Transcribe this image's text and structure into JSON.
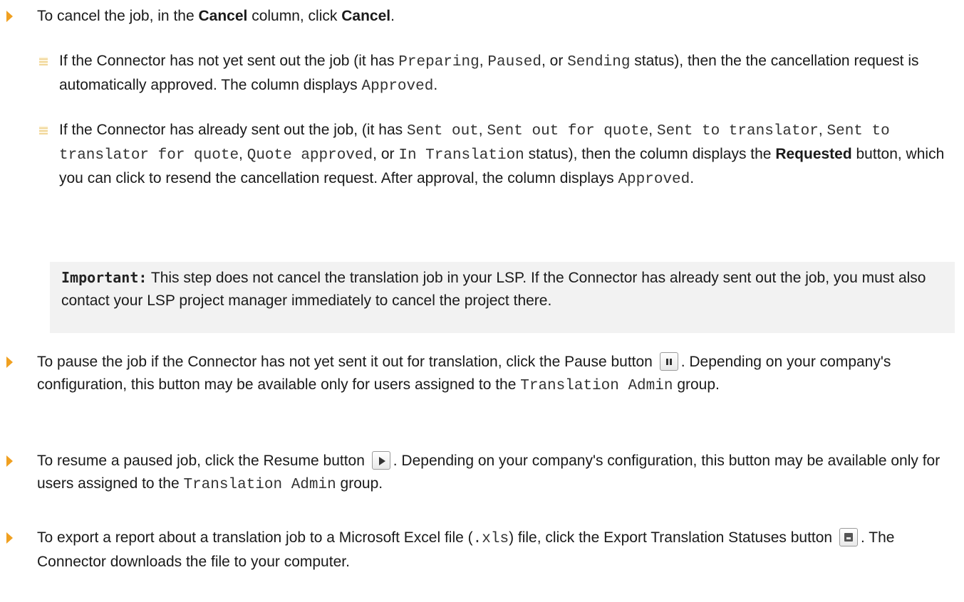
{
  "b1": {
    "p1": "To cancel the job, in the ",
    "bold1": "Cancel",
    "p2": " column, click ",
    "bold2": "Cancel",
    "p3": "."
  },
  "s1": {
    "t1": "If the Connector has not yet sent out the job (it has ",
    "m1": "Preparing",
    "t2": ", ",
    "m2": "Paused",
    "t3": ", or ",
    "m3": "Sending",
    "t4": " status), then the the cancellation request is automatically approved. The column displays ",
    "m4": "Approved",
    "t5": "."
  },
  "s2": {
    "t1": "If the Connector has already sent out the job, (it has ",
    "m1": "Sent out",
    "t2": ", ",
    "m2": "Sent out for quote",
    "t3": ", ",
    "m3": "Sent to translator",
    "t4": ", ",
    "m4": "Sent to translator for quote",
    "t5": ", ",
    "m5": "Quote approved",
    "t6": ", or ",
    "m6": "In Translation",
    "t7": " status), then the column displays the ",
    "b1": "Requested",
    "t8": " button, which you can click to resend the cancellation request. After approval, the column displays ",
    "m7": "Approved",
    "t9": "."
  },
  "note": {
    "label": "Important:",
    "text": " This step does not cancel the translation job in your LSP. If the Connector has already sent out the job, you must also contact your LSP project manager immediately to cancel the project there."
  },
  "b2": {
    "p1": "To pause the job if the Connector has not yet sent it out for translation, click the Pause button ",
    "p2": ". Depending on your company's configuration, this button may be available only for users assigned to the ",
    "m1": "Translation Admin",
    "p3": " group."
  },
  "b3": {
    "p1": "To resume a paused job, click the Resume button ",
    "p2": ". Depending on your company's configuration, this button may be available only for users assigned to the ",
    "m1": "Translation Admin",
    "p3": " group."
  },
  "b4": {
    "p1": "To export a report about a translation job to a Microsoft Excel file (",
    "m1": ".xls",
    "p2": ") file, click the Export Translation Statuses button ",
    "p3": ". The Connector downloads the file to your computer."
  },
  "icons": {
    "bullet_color": "#f0a020",
    "sub_bullet_color": "#f1d79a"
  }
}
